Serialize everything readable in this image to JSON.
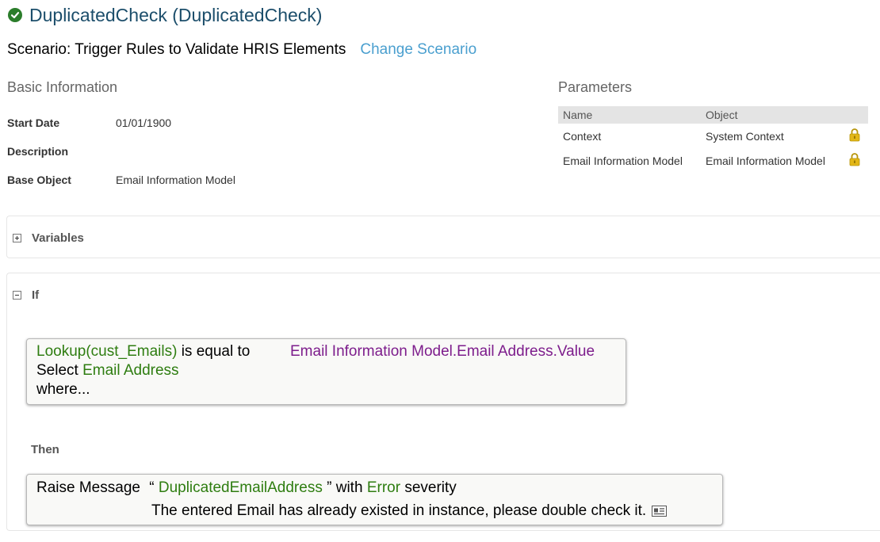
{
  "header": {
    "title": "DuplicatedCheck (DuplicatedCheck)",
    "status_icon": "check-circle-icon",
    "status_color": "#2b7d2b"
  },
  "scenario": {
    "text": "Scenario: Trigger Rules to Validate HRIS Elements",
    "change_link": "Change Scenario"
  },
  "basic_info": {
    "heading": "Basic Information",
    "start_date_label": "Start Date",
    "start_date_value": "01/01/1900",
    "description_label": "Description",
    "description_value": "",
    "base_object_label": "Base Object",
    "base_object_value": "Email Information Model"
  },
  "parameters": {
    "heading": "Parameters",
    "columns": [
      "Name",
      "Object"
    ],
    "rows": [
      {
        "name": "Context",
        "object": "System Context",
        "icon": "lock-icon"
      },
      {
        "name": "Email Information Model",
        "object": "Email Information Model",
        "icon": "lock-icon"
      }
    ]
  },
  "variables": {
    "label": "Variables",
    "expanded": false
  },
  "if_section": {
    "label": "If",
    "expanded": true,
    "condition": {
      "lookup": "Lookup(cust_Emails)",
      "operator": "is equal to",
      "right_value": "Email Information Model.Email Address.Value",
      "select_keyword": "Select",
      "select_field": "Email Address",
      "where_text": "where..."
    }
  },
  "then_section": {
    "label": "Then",
    "action": {
      "prefix": "Raise Message",
      "open_quote": "“",
      "message_key": "DuplicatedEmailAddress",
      "close_quote": "” with",
      "severity": "Error",
      "suffix": "severity",
      "message_text": "The entered Email has already existed in instance, please double check it.",
      "icon": "message-details-icon"
    }
  },
  "colors": {
    "title": "#1c4e6b",
    "link": "#4a9fcf",
    "rule_green": "#2e7d10",
    "rule_purple": "#7d1d8c"
  }
}
